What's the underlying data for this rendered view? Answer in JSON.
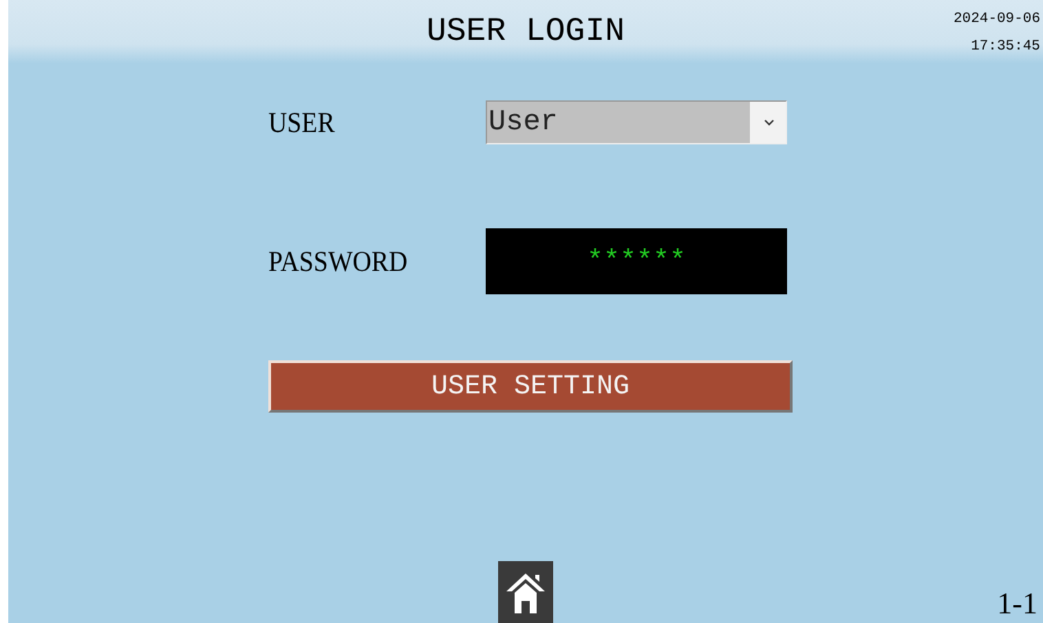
{
  "header": {
    "title": "USER LOGIN",
    "date": "2024-09-06",
    "time": "17:35:45"
  },
  "user": {
    "label": "USER",
    "value": "User"
  },
  "password": {
    "label": "PASSWORD",
    "value": "******"
  },
  "button": {
    "label": "USER SETTING"
  },
  "page_number": "1-1"
}
